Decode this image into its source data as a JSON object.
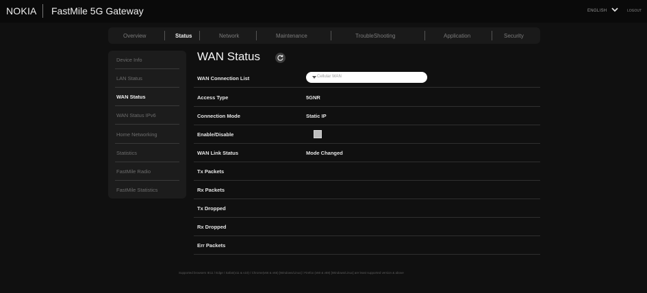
{
  "header": {
    "brand": "NOKIA",
    "product": "FastMile 5G Gateway",
    "language": "ENGLISH",
    "logout": "LOGOUT"
  },
  "tabs": [
    {
      "label": "Overview"
    },
    {
      "label": "Status"
    },
    {
      "label": "Network"
    },
    {
      "label": "Maintenance"
    },
    {
      "label": "TroubleShooting"
    },
    {
      "label": "Application"
    },
    {
      "label": "Security"
    }
  ],
  "active_tab": "Status",
  "sidebar": {
    "items": [
      {
        "label": "Device Info"
      },
      {
        "label": "LAN Status"
      },
      {
        "label": "WAN Status"
      },
      {
        "label": "WAN Status IPv6"
      },
      {
        "label": "Home Networking"
      },
      {
        "label": "Statistics"
      },
      {
        "label": "FastMile Radio"
      },
      {
        "label": "FastMile Statistics"
      }
    ],
    "active": "WAN Status"
  },
  "page": {
    "title": "WAN Status",
    "rows": [
      {
        "label": "WAN Connection List",
        "value": "Cellular WAN"
      },
      {
        "label": "Access Type",
        "value": "5GNR"
      },
      {
        "label": "Connection Mode",
        "value": "Static IP"
      },
      {
        "label": "Enable/Disable",
        "value": ""
      },
      {
        "label": "WAN Link Status",
        "value": "Mode Changed"
      },
      {
        "label": "Tx Packets",
        "value": ""
      },
      {
        "label": "Rx Packets",
        "value": ""
      },
      {
        "label": "Tx Dropped",
        "value": ""
      },
      {
        "label": "Rx Dropped",
        "value": ""
      },
      {
        "label": "Err Packets",
        "value": ""
      }
    ]
  },
  "icons": {
    "refresh": "refresh-icon",
    "chevron": "chevron-down-icon",
    "caret": "caret-down-icon"
  },
  "colors": {
    "background": "#101010",
    "panel": "#1c1c1c",
    "text_active": "#f2f2f2",
    "text_muted": "#7c7c7c",
    "select_bg": "#ffffff"
  },
  "footer": "Supported browsers IE11 / Edge / Safari(v11 & v10) / Chrome(v66 & v65) [Windows/Linux] / Firefox (v60 & v59) [Windows/Linux] are least supported version & above"
}
